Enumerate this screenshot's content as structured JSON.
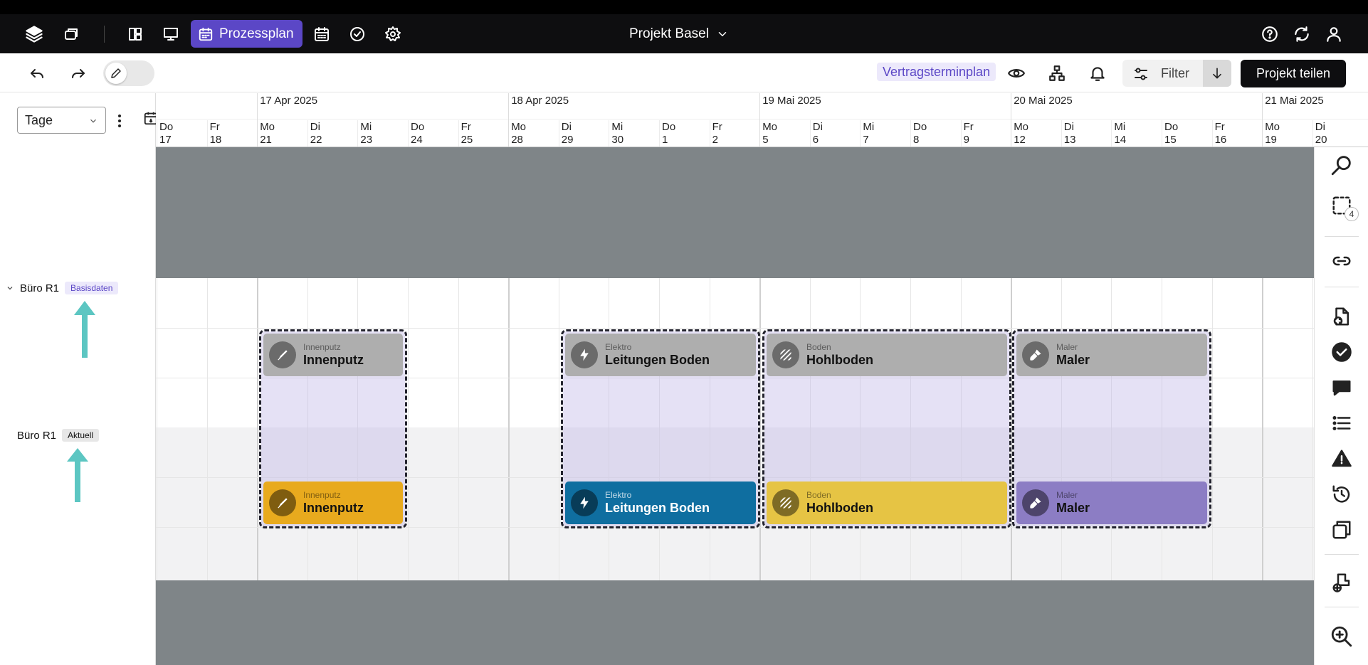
{
  "appbar": {
    "active_tab_label": "Prozessplan",
    "project_title": "Projekt Basel"
  },
  "toolbar": {
    "plan_badge": "Vertragsterminplan",
    "filter_label": "Filter",
    "share_label": "Projekt teilen"
  },
  "leftpanel": {
    "scale_select": "Tage",
    "rows": [
      {
        "label": "Büro R1",
        "badge": "Basisdaten"
      },
      {
        "label": "Büro R1",
        "badge": "Aktuell"
      }
    ]
  },
  "timeline": {
    "weeks": [
      "17 Apr 2025",
      "18 Apr 2025",
      "19 Mai 2025",
      "20 Mai 2025",
      "21 Mai 2025"
    ],
    "days": [
      {
        "wd": "Do",
        "d": "17"
      },
      {
        "wd": "Fr",
        "d": "18"
      },
      {
        "wd": "Mo",
        "d": "21"
      },
      {
        "wd": "Di",
        "d": "22"
      },
      {
        "wd": "Mi",
        "d": "23"
      },
      {
        "wd": "Do",
        "d": "24"
      },
      {
        "wd": "Fr",
        "d": "25"
      },
      {
        "wd": "Mo",
        "d": "28"
      },
      {
        "wd": "Di",
        "d": "29"
      },
      {
        "wd": "Mi",
        "d": "30"
      },
      {
        "wd": "Do",
        "d": "1"
      },
      {
        "wd": "Fr",
        "d": "2"
      },
      {
        "wd": "Mo",
        "d": "5"
      },
      {
        "wd": "Di",
        "d": "6"
      },
      {
        "wd": "Mi",
        "d": "7"
      },
      {
        "wd": "Do",
        "d": "8"
      },
      {
        "wd": "Fr",
        "d": "9"
      },
      {
        "wd": "Mo",
        "d": "12"
      },
      {
        "wd": "Di",
        "d": "13"
      },
      {
        "wd": "Mi",
        "d": "14"
      },
      {
        "wd": "Do",
        "d": "15"
      },
      {
        "wd": "Fr",
        "d": "16"
      },
      {
        "wd": "Mo",
        "d": "19"
      },
      {
        "wd": "Di",
        "d": "20"
      }
    ]
  },
  "tasks": [
    {
      "category": "Innenputz",
      "name": "Innenputz",
      "color": "#e8aa1e"
    },
    {
      "category": "Elektro",
      "name": "Leitungen Boden",
      "color": "#0f6ea0"
    },
    {
      "category": "Boden",
      "name": "Hohlboden",
      "color": "#e6c444"
    },
    {
      "category": "Maler",
      "name": "Maler",
      "color": "#8c7dc4"
    }
  ],
  "sidebar": {
    "selection_count": "4"
  }
}
